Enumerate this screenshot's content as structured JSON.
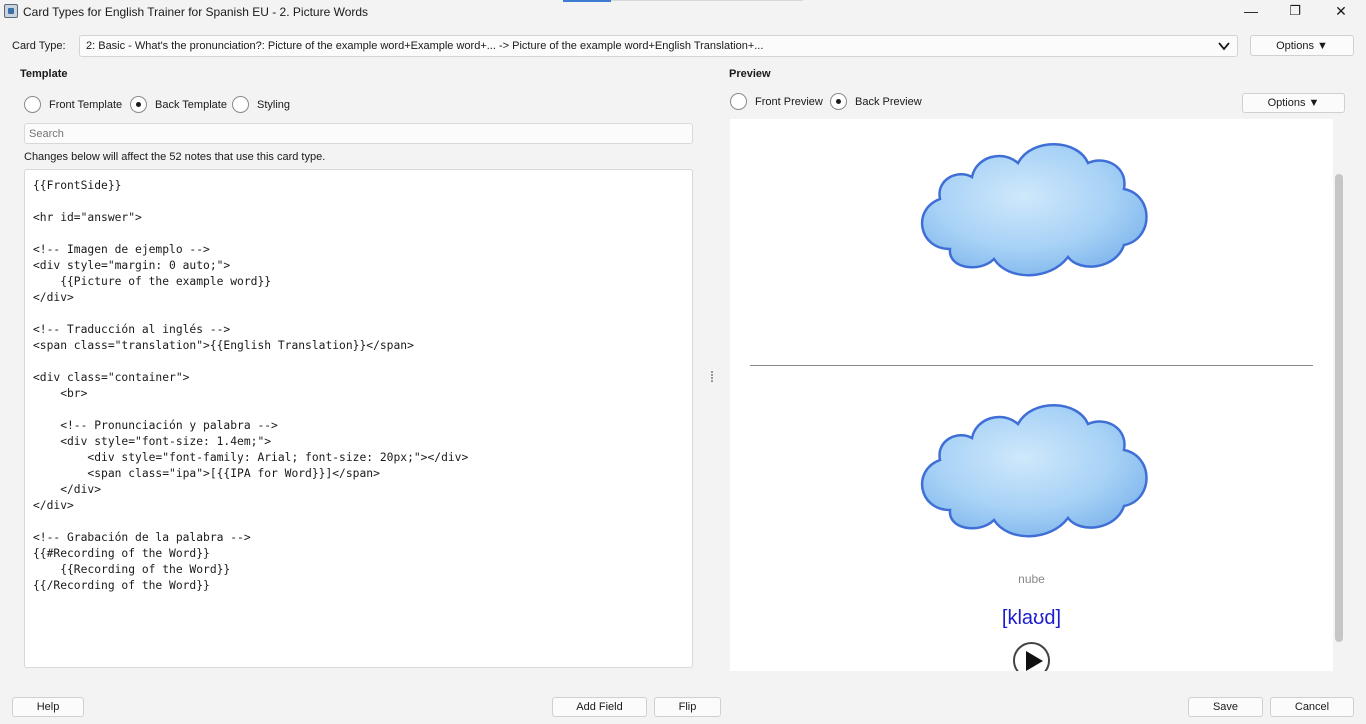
{
  "window": {
    "title": "Card Types for English Trainer for Spanish EU - 2. Picture Words",
    "minimize": "—",
    "maximize": "❐",
    "close": "✕"
  },
  "card_type": {
    "label": "Card Type:",
    "value": "2: Basic - What's the pronunciation?: Picture of the example word+Example word+... -> Picture of the example word+English Translation+...",
    "options_label": "Options ▼"
  },
  "template": {
    "heading": "Template",
    "radios": [
      {
        "label": "Front Template",
        "checked": false
      },
      {
        "label": "Back Template",
        "checked": true
      },
      {
        "label": "Styling",
        "checked": false
      }
    ],
    "search_placeholder": "Search",
    "info": "Changes below will affect the 52 notes that use this card type.",
    "code": "{{FrontSide}}\n\n<hr id=\"answer\">\n\n<!-- Imagen de ejemplo -->\n<div style=\"margin: 0 auto;\">\n    {{Picture of the example word}}\n</div>\n\n<!-- Traducción al inglés -->\n<span class=\"translation\">{{English Translation}}</span>\n\n<div class=\"container\">\n    <br>\n\n    <!-- Pronunciación y palabra -->\n    <div style=\"font-size: 1.4em;\">\n        <div style=\"font-family: Arial; font-size: 20px;\"></div>\n        <span class=\"ipa\">[{{IPA for Word}}]</span>\n    </div>\n</div>\n\n<!-- Grabación de la palabra -->\n{{#Recording of the Word}}\n    {{Recording of the Word}}\n{{/Recording of the Word}}"
  },
  "preview": {
    "heading": "Preview",
    "radios": [
      {
        "label": "Front Preview",
        "checked": false
      },
      {
        "label": "Back Preview",
        "checked": true
      }
    ],
    "options_label": "Options ▼",
    "card": {
      "word": "cloud",
      "translation": "nube",
      "ipa": "[klaʊd]"
    }
  },
  "footer": {
    "help": "Help",
    "add_field": "Add Field",
    "flip": "Flip",
    "save": "Save",
    "cancel": "Cancel"
  }
}
